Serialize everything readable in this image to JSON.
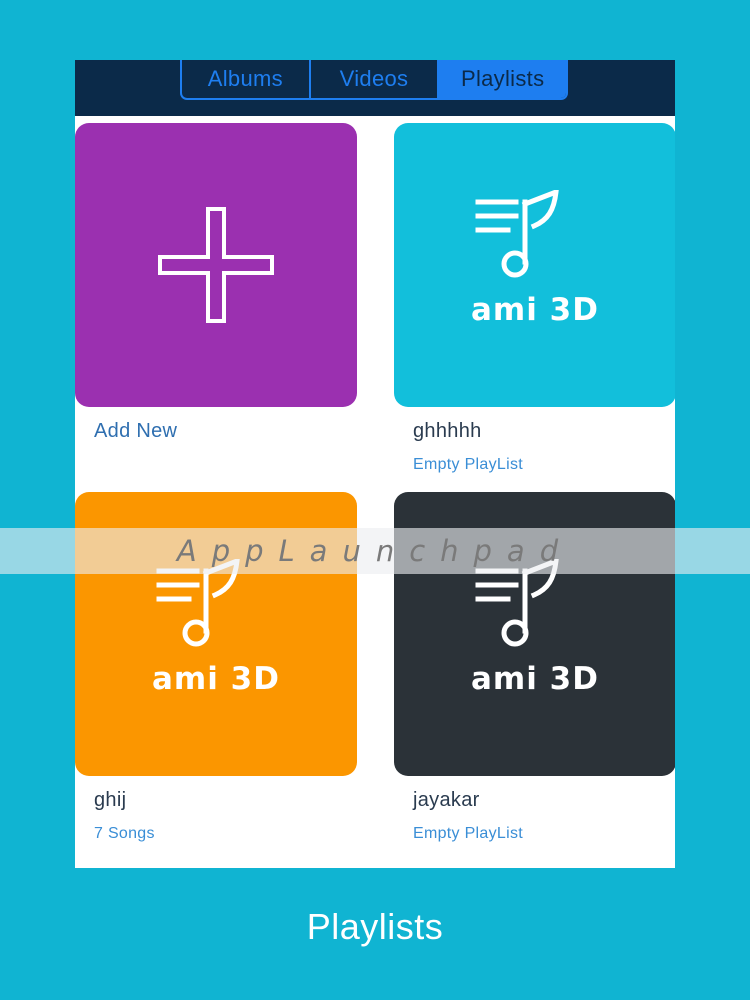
{
  "tabs": [
    {
      "label": "Albums",
      "active": false
    },
    {
      "label": "Videos",
      "active": false
    },
    {
      "label": "Playlists",
      "active": true
    }
  ],
  "tiles": [
    {
      "name": "Add New",
      "subtitle": "",
      "color": "#9b30b0",
      "icon": "plus-icon"
    },
    {
      "name": "ghhhhh",
      "subtitle": "Empty PlayList",
      "color": "#12bfdb",
      "icon": "music-note-icon",
      "logo_text": "ami 3D"
    },
    {
      "name": "ghij",
      "subtitle": "7 Songs",
      "color": "#fb9600",
      "icon": "music-note-icon",
      "logo_text": "ami 3D"
    },
    {
      "name": "jayakar",
      "subtitle": "Empty PlayList",
      "color": "#2b3238",
      "icon": "music-note-icon",
      "logo_text": "ami 3D"
    }
  ],
  "watermark": "AppLaunchpad",
  "caption": "Playlists",
  "colors": {
    "background": "#10b4d2",
    "top_bar": "#0b2a49",
    "accent": "#1e7ef0"
  }
}
